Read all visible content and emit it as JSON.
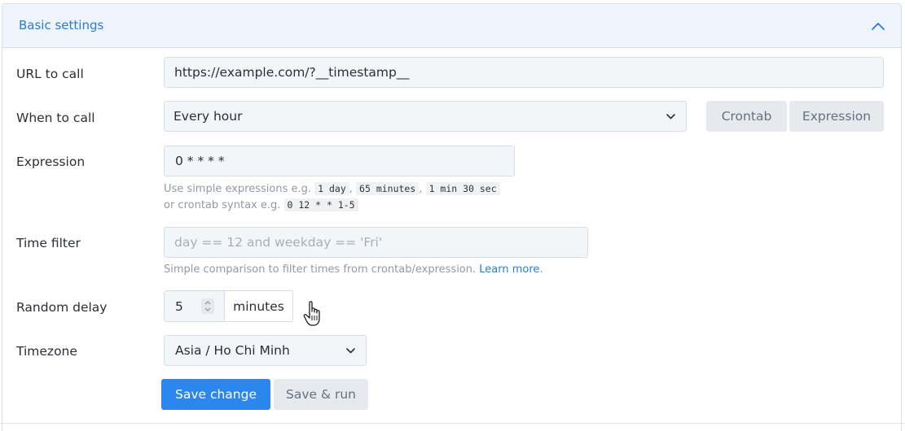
{
  "panel": {
    "title": "Basic settings"
  },
  "url": {
    "label": "URL to call",
    "value": "https://example.com/?__timestamp__"
  },
  "when": {
    "label": "When to call",
    "selected": "Every hour",
    "crontab_label": "Crontab",
    "expression_label": "Expression"
  },
  "expression": {
    "label": "Expression",
    "value": "0 * * * *",
    "hint_prefix": "Use simple expressions e.g.",
    "examples": [
      "1 day",
      "65 minutes",
      "1 min 30 sec"
    ],
    "hint_crontab_prefix": "or crontab syntax e.g.",
    "crontab_example": "0 12 * * 1-5"
  },
  "time_filter": {
    "label": "Time filter",
    "placeholder": "day == 12 and weekday == 'Fri'",
    "hint": "Simple comparison to filter times from crontab/expression.",
    "learn_more": "Learn more"
  },
  "random_delay": {
    "label": "Random delay",
    "value": "5",
    "unit": "minutes"
  },
  "timezone": {
    "label": "Timezone",
    "selected": "Asia / Ho Chi Minh"
  },
  "actions": {
    "save_label": "Save change",
    "save_run_label": "Save & run"
  },
  "colors": {
    "primary": "#2b86ee",
    "link": "#2b7ccf",
    "header_bg": "#edf4fc"
  }
}
